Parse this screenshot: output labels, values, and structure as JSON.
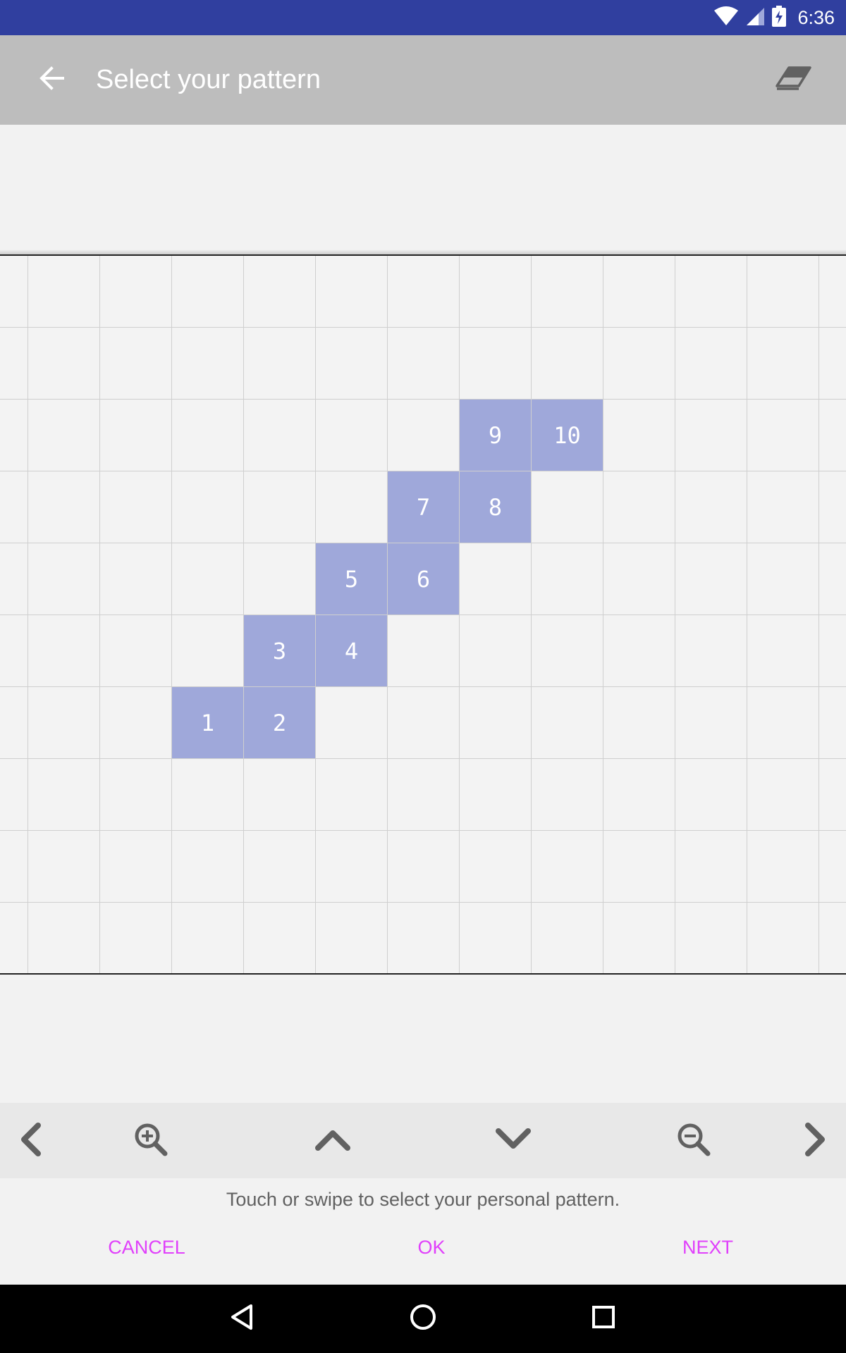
{
  "status_bar": {
    "time": "6:36",
    "icons": [
      "wifi-icon",
      "cell-signal-icon",
      "battery-charging-icon"
    ]
  },
  "app_bar": {
    "title": "Select your pattern",
    "back_icon": "arrow-back-icon",
    "clear_icon": "eraser-icon"
  },
  "grid": {
    "rows": 10,
    "cols": 13,
    "selected_color": "#9fa8da",
    "selected_cells": [
      {
        "label": "1",
        "row": 6,
        "col": 3
      },
      {
        "label": "2",
        "row": 6,
        "col": 4
      },
      {
        "label": "3",
        "row": 5,
        "col": 4
      },
      {
        "label": "4",
        "row": 5,
        "col": 5
      },
      {
        "label": "5",
        "row": 4,
        "col": 5
      },
      {
        "label": "6",
        "row": 4,
        "col": 6
      },
      {
        "label": "7",
        "row": 3,
        "col": 6
      },
      {
        "label": "8",
        "row": 3,
        "col": 7
      },
      {
        "label": "9",
        "row": 2,
        "col": 7
      },
      {
        "label": "10",
        "row": 2,
        "col": 8
      }
    ]
  },
  "toolbar": {
    "items": [
      "chevron-left-icon",
      "zoom-in-icon",
      "chevron-up-icon",
      "chevron-down-icon",
      "zoom-out-icon",
      "chevron-right-icon"
    ]
  },
  "hint": "Touch or swipe to select your personal pattern.",
  "actions": {
    "cancel": "CANCEL",
    "ok": "OK",
    "next": "NEXT",
    "color": "#e040fb"
  },
  "nav_bar": {
    "items": [
      "nav-back-icon",
      "nav-home-icon",
      "nav-recents-icon"
    ]
  }
}
